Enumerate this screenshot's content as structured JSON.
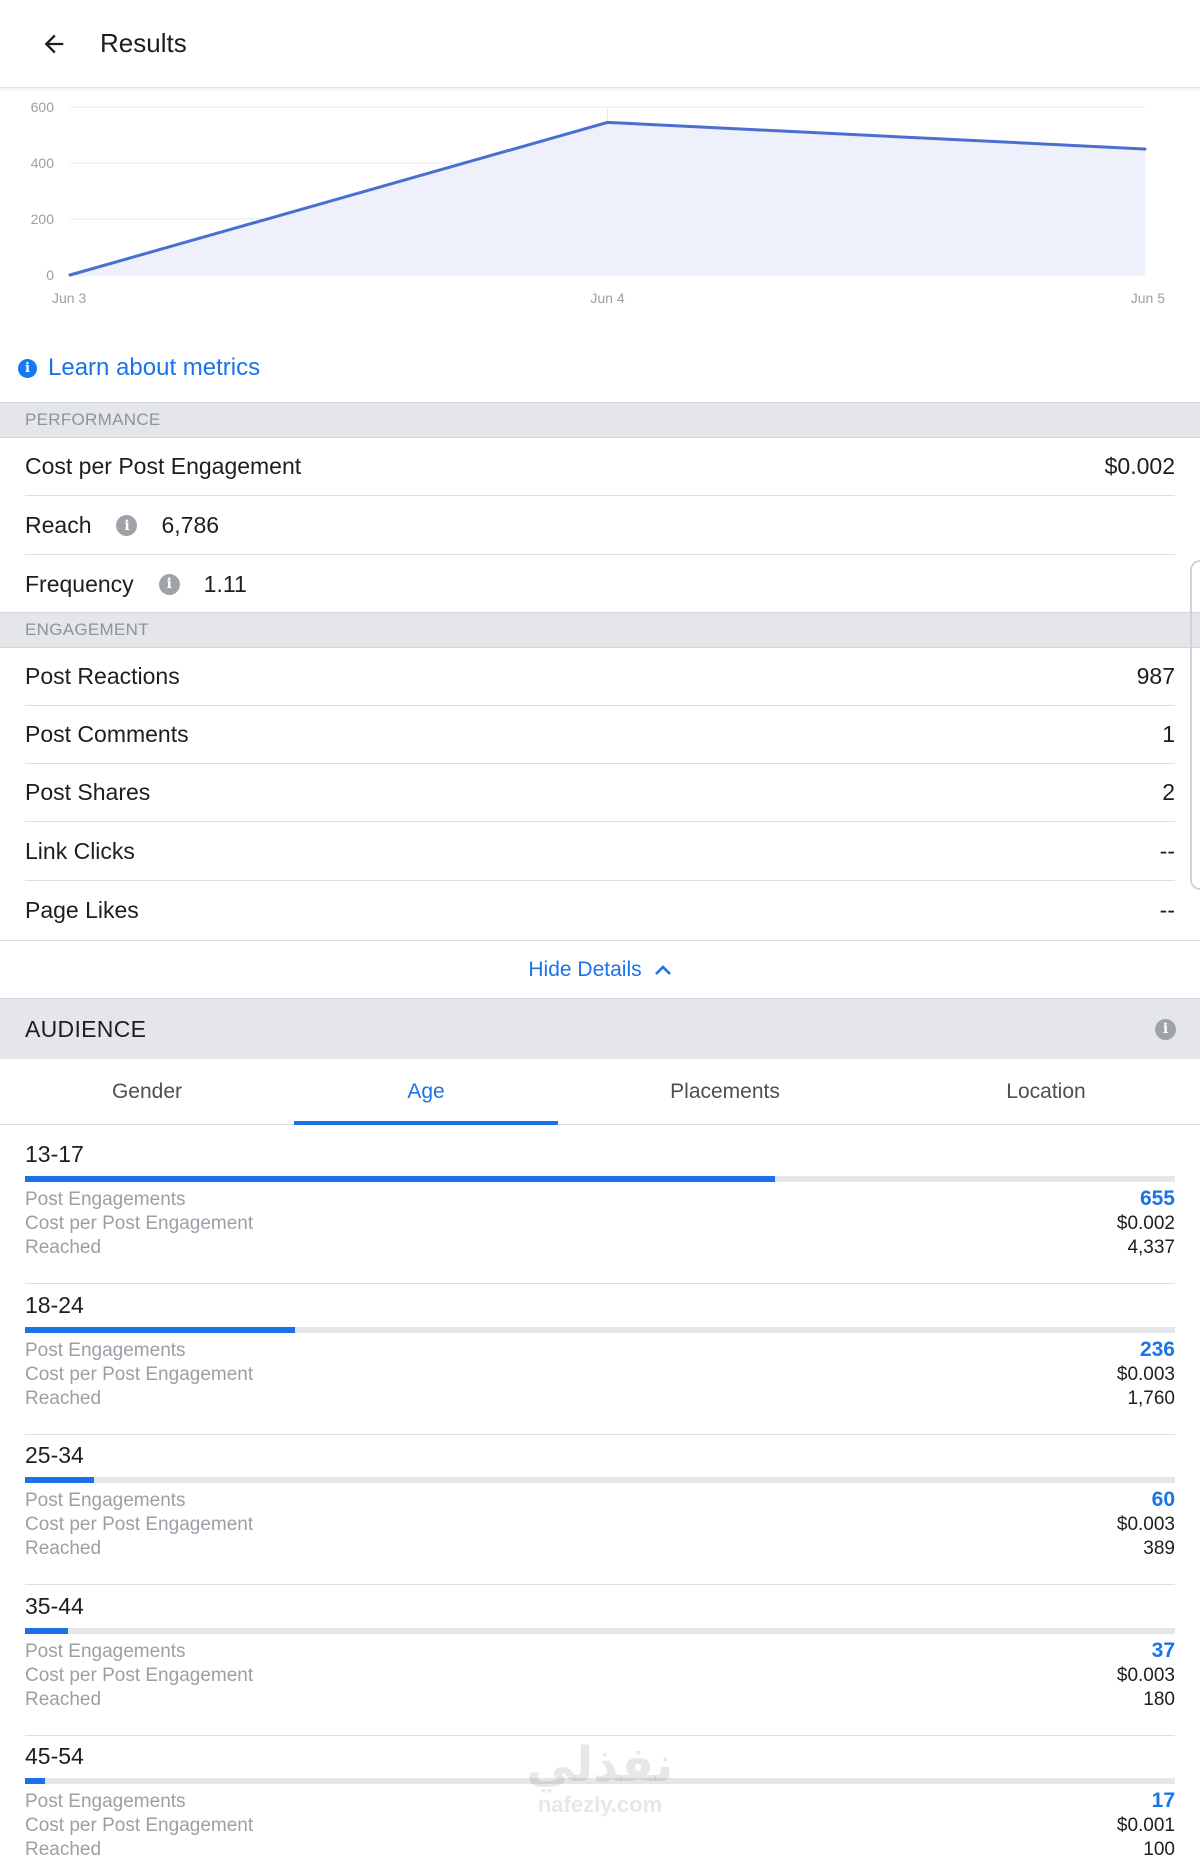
{
  "header": {
    "title": "Results",
    "back_icon": "arrow-left-icon"
  },
  "chart_data": {
    "type": "area",
    "x": [
      "Jun 3",
      "Jun 4",
      "Jun 5"
    ],
    "values": [
      0,
      545,
      450
    ],
    "ylim": [
      0,
      600
    ],
    "y_ticks": [
      0,
      200,
      400,
      600
    ],
    "grid": true,
    "color": "#4a6fd1",
    "fill_color": "#eef1fb"
  },
  "learn_link": {
    "label": "Learn about metrics",
    "icon": "info-icon"
  },
  "performance": {
    "header": "PERFORMANCE",
    "rows": [
      {
        "label": "Cost per Post Engagement",
        "value": "$0.002"
      },
      {
        "label": "Reach",
        "value": "6,786"
      },
      {
        "label": "Frequency",
        "value": "1.11"
      }
    ]
  },
  "engagement": {
    "header": "ENGAGEMENT",
    "rows": [
      {
        "label": "Post Reactions",
        "value": "987"
      },
      {
        "label": "Post Comments",
        "value": "1"
      },
      {
        "label": "Post Shares",
        "value": "2"
      },
      {
        "label": "Link Clicks",
        "value": "--"
      },
      {
        "label": "Page Likes",
        "value": "--"
      }
    ]
  },
  "hide_details": {
    "label": "Hide Details",
    "icon": "chevron-up-icon"
  },
  "audience": {
    "header": "AUDIENCE",
    "tabs": [
      "Gender",
      "Age",
      "Placements",
      "Location"
    ],
    "active_tab": "Age",
    "metric_labels": [
      "Post Engagements",
      "Cost per Post Engagement",
      "Reached"
    ],
    "groups": [
      {
        "age": "13-17",
        "engagements": "655",
        "cost": "$0.002",
        "reached": "4,337",
        "bar_fraction": 0.652
      },
      {
        "age": "18-24",
        "engagements": "236",
        "cost": "$0.003",
        "reached": "1,760",
        "bar_fraction": 0.235
      },
      {
        "age": "25-34",
        "engagements": "60",
        "cost": "$0.003",
        "reached": "389",
        "bar_fraction": 0.06
      },
      {
        "age": "35-44",
        "engagements": "37",
        "cost": "$0.003",
        "reached": "180",
        "bar_fraction": 0.037
      },
      {
        "age": "45-54",
        "engagements": "17",
        "cost": "$0.001",
        "reached": "100",
        "bar_fraction": 0.017
      }
    ]
  },
  "watermark": {
    "line1": "نفذلي",
    "line2": "nafezly.com"
  },
  "colors": {
    "accent": "#1a73e8",
    "section_bg": "#e4e6ea",
    "muted_text": "#9aa0a6"
  }
}
